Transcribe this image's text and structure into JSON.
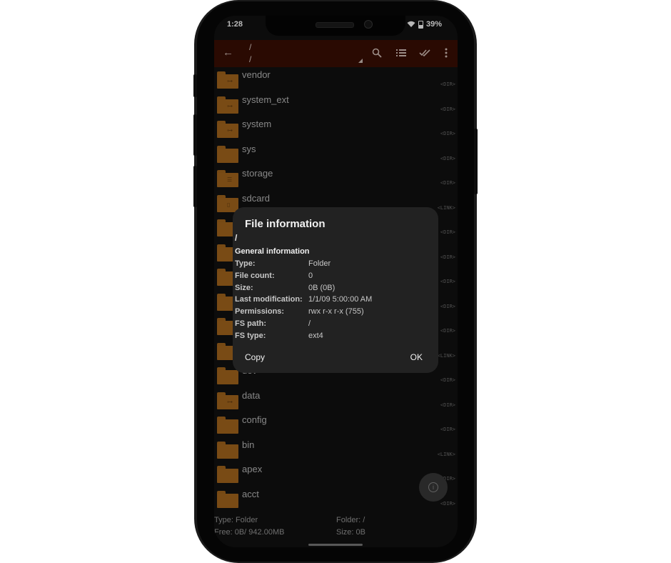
{
  "status": {
    "time": "1:28",
    "battery": "39%"
  },
  "toolbar": {
    "path_top": "/",
    "path_bottom": "/"
  },
  "files": [
    {
      "name": "vendor",
      "type": "<DIR>",
      "overlay": "link"
    },
    {
      "name": "system_ext",
      "type": "<DIR>",
      "overlay": "link"
    },
    {
      "name": "system",
      "type": "<DIR>",
      "overlay": "link"
    },
    {
      "name": "sys",
      "type": "<DIR>",
      "overlay": ""
    },
    {
      "name": "storage",
      "type": "<DIR>",
      "overlay": "list"
    },
    {
      "name": "sdcard",
      "type": "<LINK>",
      "overlay": "phone"
    },
    {
      "name": "",
      "type": "<DIR>",
      "overlay": ""
    },
    {
      "name": "",
      "type": "<DIR>",
      "overlay": ""
    },
    {
      "name": "",
      "type": "<DIR>",
      "overlay": ""
    },
    {
      "name": "",
      "type": "<DIR>",
      "overlay": ""
    },
    {
      "name": "",
      "type": "<DIR>",
      "overlay": ""
    },
    {
      "name": "",
      "type": "<LINK>",
      "overlay": ""
    },
    {
      "name": "dev",
      "type": "<DIR>",
      "overlay": ""
    },
    {
      "name": "data",
      "type": "<DIR>",
      "overlay": "link"
    },
    {
      "name": "config",
      "type": "<DIR>",
      "overlay": ""
    },
    {
      "name": "bin",
      "type": "<LINK>",
      "overlay": ""
    },
    {
      "name": "apex",
      "type": "<DIR>",
      "overlay": ""
    },
    {
      "name": "acct",
      "type": "<DIR>",
      "overlay": ""
    }
  ],
  "dialog": {
    "title": "File information",
    "path": "/",
    "section": "General information",
    "rows": [
      {
        "label": "Type:",
        "value": "Folder"
      },
      {
        "label": "File count:",
        "value": "0"
      },
      {
        "label": "Size:",
        "value": "0B (0B)"
      },
      {
        "label": "Last modification:",
        "value": "1/1/09 5:00:00 AM"
      },
      {
        "label": "Permissions:",
        "value": "rwx r-x r-x (755)"
      },
      {
        "label": "FS path:",
        "value": "/"
      },
      {
        "label": "FS type:",
        "value": "ext4"
      }
    ],
    "copy_label": "Copy",
    "ok_label": "OK"
  },
  "footer": {
    "type": "Type: Folder",
    "folder": "Folder: /",
    "free": "Free: 0B/ 942.00MB",
    "size": "Size: 0B"
  },
  "colors": {
    "toolbar": "#3b0e04",
    "folder": "#a8681e",
    "background": "#111111",
    "dialog": "#222222"
  }
}
